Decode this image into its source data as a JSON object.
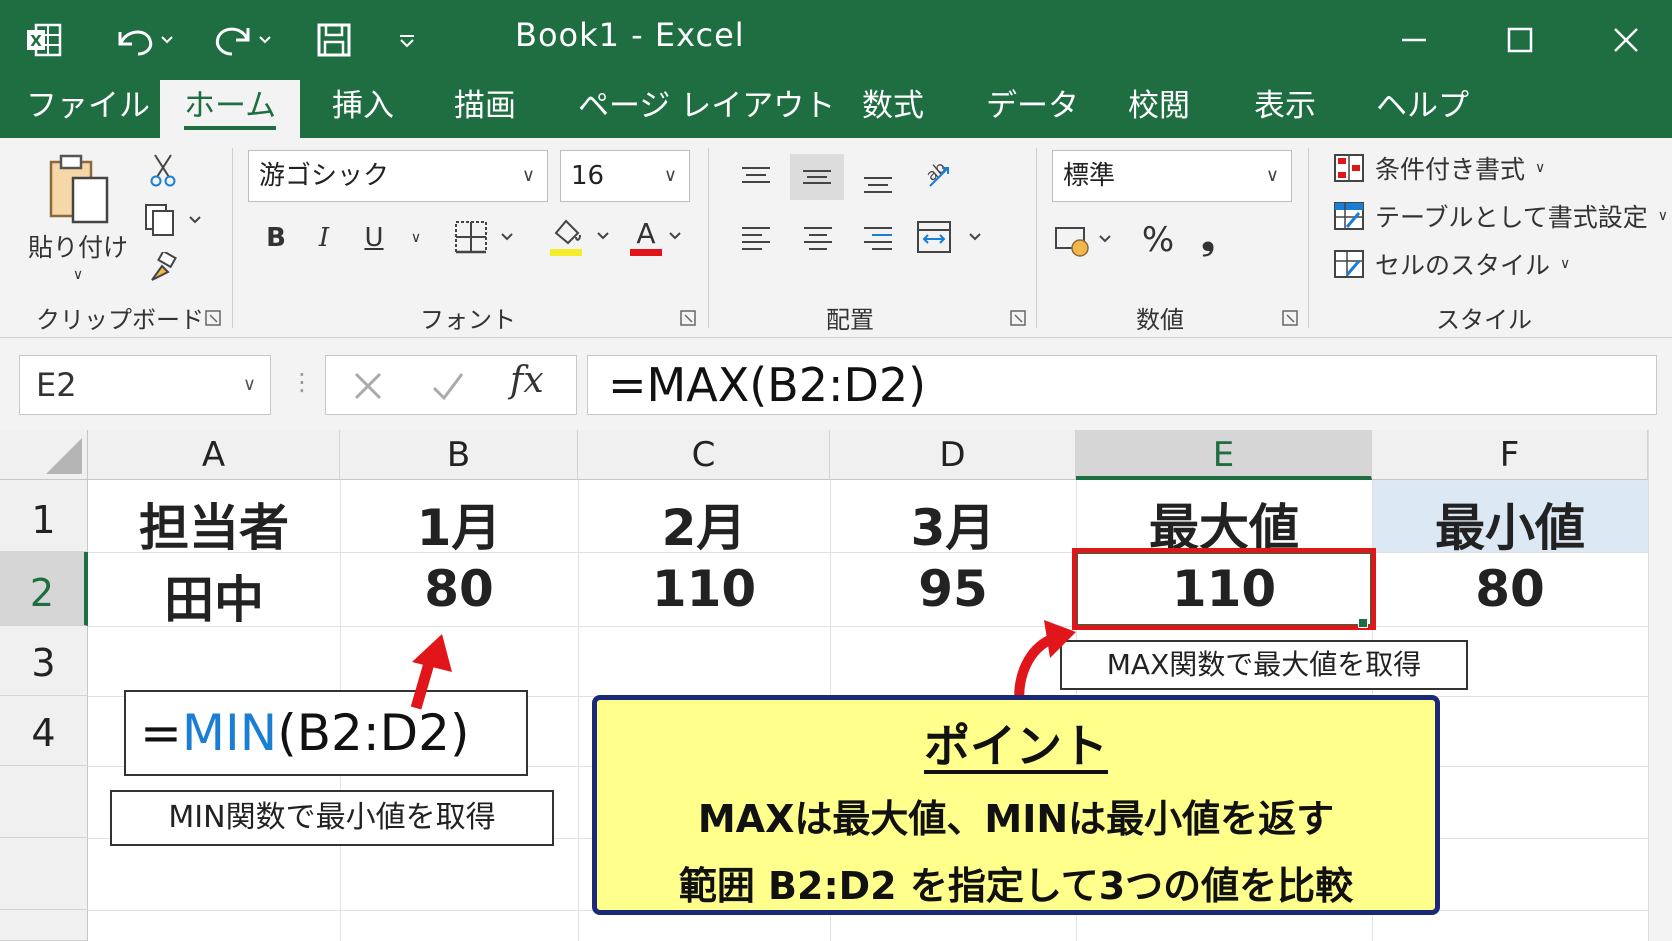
{
  "window": {
    "title": "Book1  -  Excel",
    "quick_access": [
      "excel-logo-icon",
      "undo-icon",
      "redo-icon",
      "save-icon",
      "customize-icon"
    ]
  },
  "tabs": [
    {
      "label": "ファイル",
      "active": false
    },
    {
      "label": "ホーム",
      "active": true
    },
    {
      "label": "挿入",
      "active": false
    },
    {
      "label": "描画",
      "active": false
    },
    {
      "label": "ページ レイアウト",
      "active": false
    },
    {
      "label": "数式",
      "active": false
    },
    {
      "label": "データ",
      "active": false
    },
    {
      "label": "校閲",
      "active": false
    },
    {
      "label": "表示",
      "active": false
    },
    {
      "label": "ヘルプ",
      "active": false
    }
  ],
  "ribbon": {
    "clipboard": {
      "paste_label": "貼り付け",
      "group_label": "クリップボード"
    },
    "font": {
      "font_name": "游ゴシック",
      "font_size": "16",
      "group_label": "フォント",
      "bold": "B",
      "italic": "I",
      "underline": "U",
      "font_color_letter": "A"
    },
    "alignment": {
      "group_label": "配置"
    },
    "number": {
      "format": "標準",
      "percent": "%",
      "comma": "❟",
      "group_label": "数値"
    },
    "styles": {
      "conditional": "条件付き書式",
      "as_table": "テーブルとして書式設定",
      "cell_styles": "セルのスタイル",
      "group_label": "スタイル"
    }
  },
  "formula_bar": {
    "name_box": "E2",
    "fx": "fx",
    "formula": "=MAX(B2:D2)"
  },
  "sheet": {
    "columns": [
      "A",
      "B",
      "C",
      "D",
      "E",
      "F"
    ],
    "rows": [
      "1",
      "2",
      "3",
      "4"
    ],
    "selected_cell": "E2",
    "row1": [
      "担当者",
      "1月",
      "2月",
      "3月",
      "最大値",
      "最小値"
    ],
    "row2": [
      "田中",
      "80",
      "110",
      "95",
      "110",
      "80"
    ]
  },
  "annotations": {
    "min_formula_eq": "=",
    "min_formula_fn": "MIN",
    "min_formula_args": "(B2:D2)",
    "min_caption": "MIN関数で最小値を取得",
    "max_caption": "MAX関数で最大値を取得",
    "point_title": "ポイント",
    "point_line1": "MAXは最大値、MINは最小値を返す",
    "point_line2": "範囲 B2:D2 を指定して3つの値を比較"
  },
  "colors": {
    "excel_green": "#1e6e42",
    "highlight_red": "#e0161b",
    "min_blue": "#1a7fd4",
    "point_bg": "#ffff8c",
    "point_border": "#1a2a78",
    "f1_fill": "#dde8f5"
  }
}
